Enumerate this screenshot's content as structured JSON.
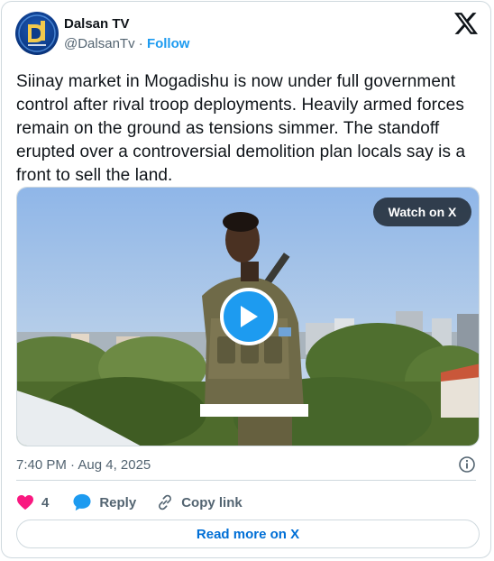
{
  "author": {
    "name": "Dalsan TV",
    "handle": "@DalsanTv",
    "separator": "·",
    "follow_label": "Follow"
  },
  "tweet": {
    "text": "Siinay market in Mogadishu is now under full government control after rival troop deployments. Heavily armed forces remain on the ground as tensions simmer. The standoff erupted over a controversial demolition plan locals say is a front to sell the land.",
    "timestamp": "7:40 PM · Aug 4, 2025"
  },
  "media": {
    "watch_label": "Watch on X"
  },
  "actions": {
    "like_count": "4",
    "reply_label": "Reply",
    "copy_link_label": "Copy link"
  },
  "footer": {
    "read_more_label": "Read more on X"
  },
  "colors": {
    "accent": "#1d9bf0",
    "like": "#f91880",
    "link": "#006fd6",
    "border": "#cfd9de",
    "muted": "#536471"
  },
  "icons": [
    "dalsan-logo-icon",
    "x-logo-icon",
    "play-icon",
    "info-icon",
    "heart-icon",
    "reply-bubble-icon",
    "link-icon"
  ]
}
